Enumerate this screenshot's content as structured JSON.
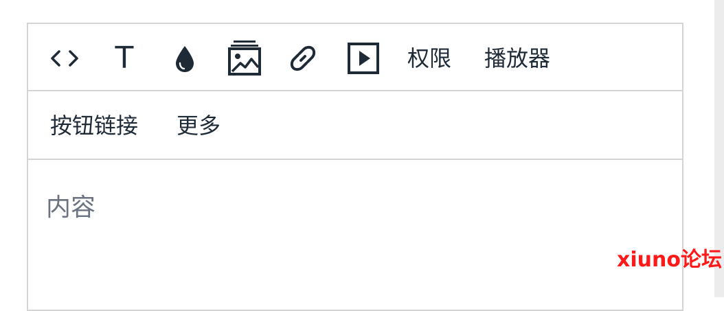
{
  "toolbar": {
    "code_icon": "code-icon",
    "text_icon_glyph": "T",
    "color_icon": "droplet-icon",
    "image_icon": "image-icon",
    "link_icon": "link-icon",
    "video_icon": "play-icon",
    "permission_label": "权限",
    "player_label": "播放器",
    "button_link_label": "按钮链接",
    "more_label": "更多"
  },
  "editor": {
    "placeholder": "内容"
  },
  "watermark": {
    "text": "xiuno论坛"
  },
  "colors": {
    "icon": "#1f2a37",
    "border": "#d4d4d4",
    "placeholder": "#6b7280",
    "watermark": "#ff1a1a"
  }
}
